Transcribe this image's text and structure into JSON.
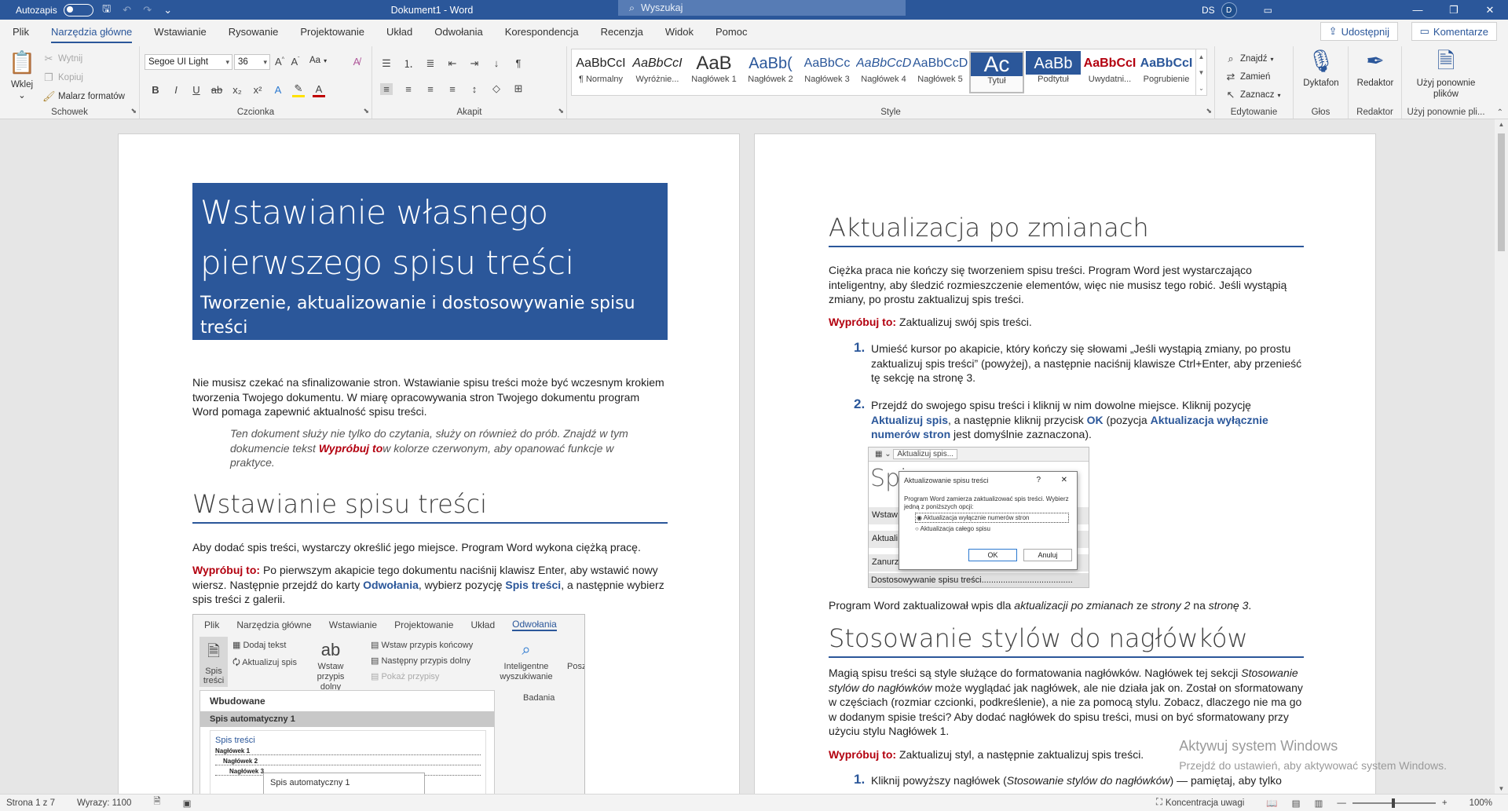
{
  "titlebar": {
    "autosave_label": "Autozapis",
    "doc_title": "Dokument1 - Word",
    "search_placeholder": "Wyszukaj",
    "user_initials": "DS",
    "user_avatar": "D"
  },
  "tabs": [
    "Plik",
    "Narzędzia główne",
    "Wstawianie",
    "Rysowanie",
    "Projektowanie",
    "Układ",
    "Odwołania",
    "Korespondencja",
    "Recenzja",
    "Widok",
    "Pomoc"
  ],
  "share_label": "Udostępnij",
  "comments_label": "Komentarze",
  "ribbon": {
    "clipboard": {
      "paste": "Wklej",
      "cut": "Wytnij",
      "copy": "Kopiuj",
      "format_painter": "Malarz formatów",
      "label": "Schowek"
    },
    "font": {
      "name": "Segoe UI Light",
      "size": "36",
      "label": "Czcionka",
      "case": "Aa"
    },
    "paragraph": {
      "label": "Akapit"
    },
    "styles": {
      "label": "Style",
      "items": [
        {
          "preview": "AaBbCcI",
          "name": "¶ Normalny"
        },
        {
          "preview": "AaBbCcI",
          "name": "Wyróżnie..."
        },
        {
          "preview": "AaB",
          "name": "Nagłówek 1"
        },
        {
          "preview": "AaBb(",
          "name": "Nagłówek 2"
        },
        {
          "preview": "AaBbCc",
          "name": "Nagłówek 3"
        },
        {
          "preview": "AaBbCcD",
          "name": "Nagłówek 4"
        },
        {
          "preview": "AaBbCcD",
          "name": "Nagłówek 5"
        },
        {
          "preview": "Ac",
          "name": "Tytuł"
        },
        {
          "preview": "AaBb",
          "name": "Podtytuł"
        },
        {
          "preview": "AaBbCcI",
          "name": "Uwydatni..."
        },
        {
          "preview": "AaBbCcI",
          "name": "Pogrubienie"
        }
      ]
    },
    "editing": {
      "find": "Znajdź",
      "replace": "Zamień",
      "select": "Zaznacz",
      "label": "Edytowanie"
    },
    "voice": {
      "dictate": "Dyktafon",
      "label": "Głos"
    },
    "editor": {
      "editor": "Redaktor",
      "label": "Redaktor"
    },
    "reuse": {
      "reuse": "Użyj ponownie plików",
      "label": "Użyj ponownie pli..."
    }
  },
  "page1": {
    "title": "Wstawianie własnego pierwszego spisu treści",
    "subtitle": "Tworzenie, aktualizowanie i dostosowywanie spisu treści",
    "intro": "Nie musisz czekać na sfinalizowanie stron. Wstawianie spisu treści może być wczesnym krokiem tworzenia Twojego dokumentu. W miarę opracowywania stron Twojego dokumentu program Word pomaga zapewnić aktualność spisu treści.",
    "quote_a": "Ten dokument służy nie tylko do czytania, służy on również do prób. Znajdź w tym dokumencie tekst ",
    "quote_try": "Wypróbuj to",
    "quote_b": "w kolorze czerwonym, aby opanować funkcje w praktyce.",
    "h1": "Wstawianie spisu treści",
    "p1": "Aby dodać spis treści, wystarczy określić jego miejsce. Program Word wykona ciężką pracę.",
    "try_label": "Wypróbuj to:",
    "p2a": " Po pierwszym akapicie tego dokumentu naciśnij klawisz Enter, aby wstawić nowy wiersz. Następnie przejdź do karty ",
    "p2b": "Odwołania",
    "p2c": ", wybierz pozycję ",
    "p2d": "Spis treści",
    "p2e": ", a następnie wybierz spis treści z galerii.",
    "shot": {
      "tabs": [
        "Plik",
        "Narzędzia główne",
        "Wstawianie",
        "Projektowanie",
        "Układ",
        "Odwołania"
      ],
      "toc": "Spis treści",
      "add_text": "Dodaj tekst",
      "update": "Aktualizuj spis",
      "insert_fn": "Wstaw przypis dolny",
      "insert_en": "Wstaw przypis końcowy",
      "next_fn": "Następny przypis dolny",
      "show_notes": "Pokaż przypisy",
      "smart": "Inteligentne wyszukiwanie",
      "search": "Poszuk",
      "research": "Badania",
      "builtin": "Wbudowane",
      "auto1": "Spis automatyczny 1",
      "toc_title": "Spis treści",
      "lvl1": "Nagłówek 1",
      "lvl2": "Nagłówek 2",
      "lvl3": "Nagłówek 3",
      "tooltip": "Spis automatyczny 1",
      "ab": "ab"
    }
  },
  "page2": {
    "h1a": "Aktualizacja po zmianach",
    "pa": "Ciężka praca nie kończy się tworzeniem spisu treści. Program Word jest wystarczająco inteligentny, aby śledzić rozmieszczenie elementów, więc nie musisz tego robić. Jeśli wystąpią zmiany, po prostu zaktualizuj spis treści.",
    "try_label": "Wypróbuj to:",
    "try_a": " Zaktualizuj swój spis treści.",
    "li1": "Umieść kursor po akapicie, który kończy się słowami „Jeśli wystąpią zmiany, po prostu zaktualizuj spis treści” (powyżej), a następnie naciśnij klawisze Ctrl+Enter, aby przenieść tę sekcję na stronę 3.",
    "li2a": "Przejdź do swojego spisu treści i kliknij w nim dowolne miejsce. Kliknij pozycję ",
    "li2b": "Aktualizuj spis",
    "li2c": ", a następnie kliknij przycisk ",
    "li2d": "OK",
    "li2e": " (pozycja ",
    "li2f": "Aktualizacja wyłącznie numerów stron",
    "li2g": " jest domyślnie zaznaczona).",
    "dialog": {
      "title": "Aktualizowanie spisu treści",
      "help": "?",
      "close": "✕",
      "msg": "Program Word zamierza zaktualizować spis treści. Wybierz jedną z poniższych opcji:",
      "opt1": "Aktualizacja wyłącznie numerów stron",
      "opt2": "Aktualizacja całego spisu",
      "ok": "OK",
      "cancel": "Anuluj",
      "bg_tab": "Aktualizuj spis...",
      "bg_title": "Spi",
      "bg_r1": "Wstaw",
      "bg_r2": "Aktuali",
      "bg_r3": "Zanurz",
      "bg_r4": "Dostosowywanie spisu treści......................................"
    },
    "after_a": "Program Word zaktualizował wpis dla ",
    "after_b": "aktualizacji po zmianach",
    "after_c": " ze ",
    "after_d": "strony 2",
    "after_e": " na ",
    "after_f": "stronę 3",
    "after_g": ".",
    "h1b": "Stosowanie stylów do nagłówków",
    "pb_a": "Magią spisu treści są style służące do formatowania nagłówków. Nagłówek tej sekcji ",
    "pb_b": "Stosowanie stylów do nagłówków",
    "pb_c": " może wyglądać jak nagłówek, ale nie działa jak on. Został on sformatowany w częściach (rozmiar czcionki, podkreślenie), a nie za pomocą stylu. Zobacz, dlaczego nie ma go w dodanym spisie treści? Aby dodać nagłówek do spisu treści, musi on być sformatowany przy użyciu stylu Nagłówek 1.",
    "try_b": " Zaktualizuj styl, a następnie zaktualizuj spis treści.",
    "li3a": "Kliknij powyższy nagłówek (",
    "li3b": "Stosowanie stylów do nagłówków",
    "li3c": ") — pamiętaj, aby tylko"
  },
  "watermark": {
    "line1": "Aktywuj system Windows",
    "line2": "Przejdź do ustawień, aby aktywować system Windows."
  },
  "status": {
    "page": "Strona 1 z 7",
    "words": "Wyrazy: 1100",
    "focus": "Koncentracja uwagi",
    "zoom": "100%"
  }
}
